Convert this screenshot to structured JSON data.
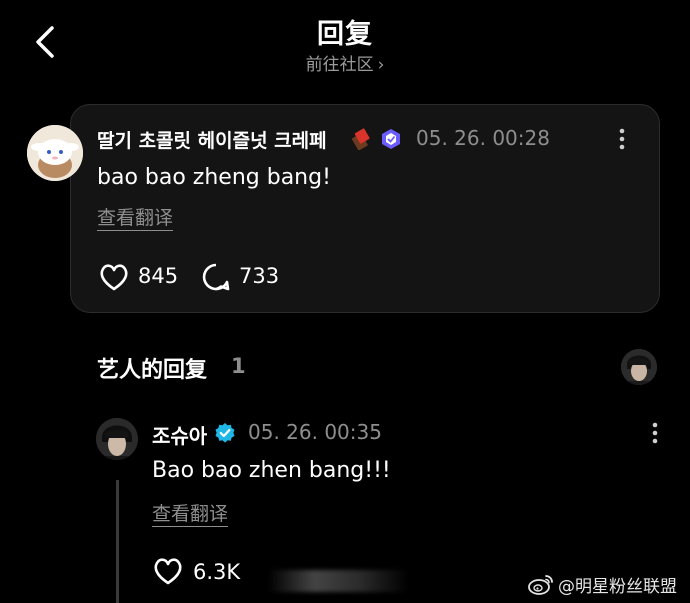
{
  "header": {
    "title": "回复",
    "subtitle": "前往社区",
    "subtitle_chevron": "›"
  },
  "comment": {
    "author": "딸기 초콜릿 헤이즐넛 크레페",
    "author_emoji_icon": "chocolate-bar-icon",
    "badge_icon": "membership-badge-icon",
    "timestamp": "05. 26. 00:28",
    "text": "bao bao zheng bang!",
    "translate_label": "查看翻译",
    "likes": "845",
    "replies": "733"
  },
  "artist_section": {
    "title": "艺人的回复",
    "count": "1"
  },
  "artist_reply": {
    "author": "조슈아",
    "verified_icon": "verified-check-icon",
    "timestamp": "05. 26. 00:35",
    "text": "Bao bao zhen bang!!!",
    "translate_label": "查看翻译",
    "likes": "6.3K"
  },
  "watermark": {
    "text": "@明星粉丝联盟",
    "logo_icon": "weibo-logo-icon"
  },
  "colors": {
    "background": "#000000",
    "card": "#141414",
    "muted_text": "#8e8e8e",
    "verified_blue": "#1fb8e6",
    "badge_purple": "#6b5cff"
  }
}
